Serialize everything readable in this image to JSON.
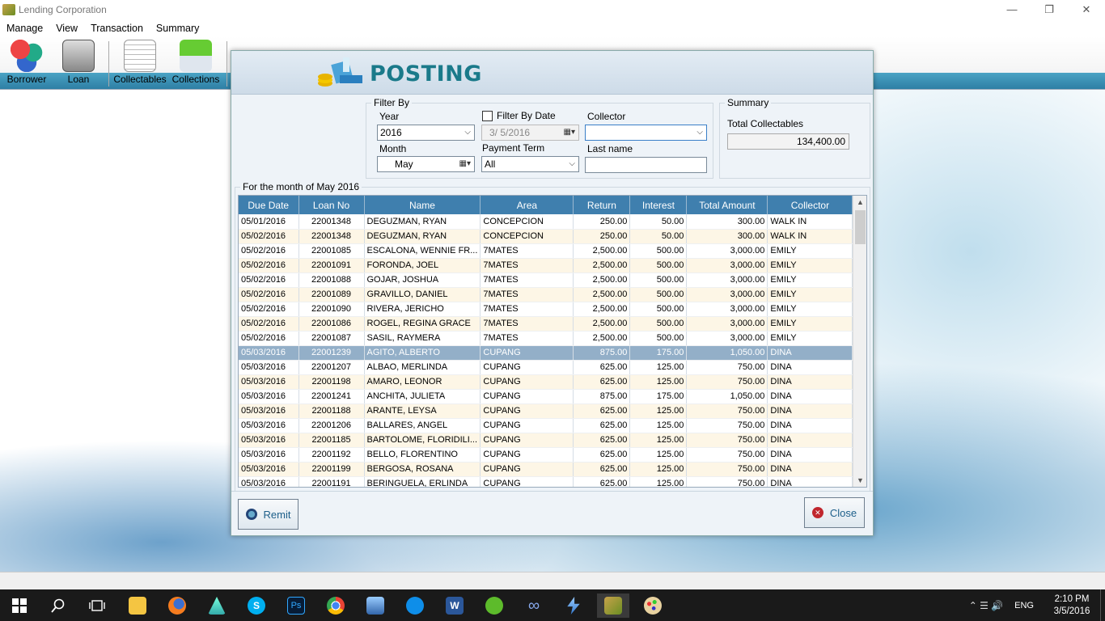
{
  "window": {
    "title": "Lending Corporation",
    "minimize": "—",
    "restore": "❐",
    "close": "✕"
  },
  "menu": [
    "Manage",
    "View",
    "Transaction",
    "Summary"
  ],
  "toolbar": {
    "borrower": "Borrower",
    "loan": "Loan",
    "collectables": "Collectables",
    "collections": "Collections"
  },
  "dialog": {
    "title": "POSTING",
    "filter": {
      "group_label": "Filter By",
      "year_label": "Year",
      "year_value": "2016",
      "filter_by_date_label": "Filter By Date",
      "date_value": "3/  5/2016",
      "collector_label": "Collector",
      "collector_value": "",
      "month_label": "Month",
      "month_value": "May",
      "payment_term_label": "Payment Term",
      "payment_term_value": "All",
      "last_name_label": "Last name",
      "last_name_value": ""
    },
    "summary": {
      "group_label": "Summary",
      "total_collectables_label": "Total Collectables",
      "total_collectables_value": "134,400.00"
    },
    "grid": {
      "group_label": "For the month of May 2016",
      "columns": [
        "Due Date",
        "Loan No",
        "Name",
        "Area",
        "Return",
        "Interest",
        "Total Amount",
        "Collector"
      ],
      "rows": [
        [
          "05/01/2016",
          "22001348",
          "DEGUZMAN, RYAN",
          "CONCEPCION",
          "250.00",
          "50.00",
          "300.00",
          "WALK IN"
        ],
        [
          "05/02/2016",
          "22001348",
          "DEGUZMAN, RYAN",
          "CONCEPCION",
          "250.00",
          "50.00",
          "300.00",
          "WALK IN"
        ],
        [
          "05/02/2016",
          "22001085",
          "ESCALONA, WENNIE FR...",
          "7MATES",
          "2,500.00",
          "500.00",
          "3,000.00",
          "EMILY"
        ],
        [
          "05/02/2016",
          "22001091",
          "FORONDA, JOEL",
          "7MATES",
          "2,500.00",
          "500.00",
          "3,000.00",
          "EMILY"
        ],
        [
          "05/02/2016",
          "22001088",
          "GOJAR, JOSHUA",
          "7MATES",
          "2,500.00",
          "500.00",
          "3,000.00",
          "EMILY"
        ],
        [
          "05/02/2016",
          "22001089",
          "GRAVILLO, DANIEL",
          "7MATES",
          "2,500.00",
          "500.00",
          "3,000.00",
          "EMILY"
        ],
        [
          "05/02/2016",
          "22001090",
          "RIVERA, JERICHO",
          "7MATES",
          "2,500.00",
          "500.00",
          "3,000.00",
          "EMILY"
        ],
        [
          "05/02/2016",
          "22001086",
          "ROGEL, REGINA GRACE",
          "7MATES",
          "2,500.00",
          "500.00",
          "3,000.00",
          "EMILY"
        ],
        [
          "05/02/2016",
          "22001087",
          "SASIL, RAYMERA",
          "7MATES",
          "2,500.00",
          "500.00",
          "3,000.00",
          "EMILY"
        ],
        [
          "05/03/2016",
          "22001239",
          "AGITO, ALBERTO",
          "CUPANG",
          "875.00",
          "175.00",
          "1,050.00",
          "DINA"
        ],
        [
          "05/03/2016",
          "22001207",
          "ALBAO, MERLINDA",
          "CUPANG",
          "625.00",
          "125.00",
          "750.00",
          "DINA"
        ],
        [
          "05/03/2016",
          "22001198",
          "AMARO, LEONOR",
          "CUPANG",
          "625.00",
          "125.00",
          "750.00",
          "DINA"
        ],
        [
          "05/03/2016",
          "22001241",
          "ANCHITA, JULIETA",
          "CUPANG",
          "875.00",
          "175.00",
          "1,050.00",
          "DINA"
        ],
        [
          "05/03/2016",
          "22001188",
          "ARANTE, LEYSA",
          "CUPANG",
          "625.00",
          "125.00",
          "750.00",
          "DINA"
        ],
        [
          "05/03/2016",
          "22001206",
          "BALLARES, ANGEL",
          "CUPANG",
          "625.00",
          "125.00",
          "750.00",
          "DINA"
        ],
        [
          "05/03/2016",
          "22001185",
          "BARTOLOME, FLORIDILI...",
          "CUPANG",
          "625.00",
          "125.00",
          "750.00",
          "DINA"
        ],
        [
          "05/03/2016",
          "22001192",
          "BELLO, FLORENTINO",
          "CUPANG",
          "625.00",
          "125.00",
          "750.00",
          "DINA"
        ],
        [
          "05/03/2016",
          "22001199",
          "BERGOSA, ROSANA",
          "CUPANG",
          "625.00",
          "125.00",
          "750.00",
          "DINA"
        ],
        [
          "05/03/2016",
          "22001191",
          "BERINGUELA, ERLINDA",
          "CUPANG",
          "625.00",
          "125.00",
          "750.00",
          "DINA"
        ]
      ],
      "selected_row": 9
    },
    "buttons": {
      "remit": "Remit",
      "close": "Close"
    }
  },
  "taskbar": {
    "time": "2:10 PM",
    "date": "3/5/2016",
    "language": "ENG"
  },
  "colors": {
    "grid_header": "#3f7fae",
    "selected_row": "#93afc8",
    "title_accent": "#1a7a8a",
    "taskbar": "#1a1a1a"
  }
}
